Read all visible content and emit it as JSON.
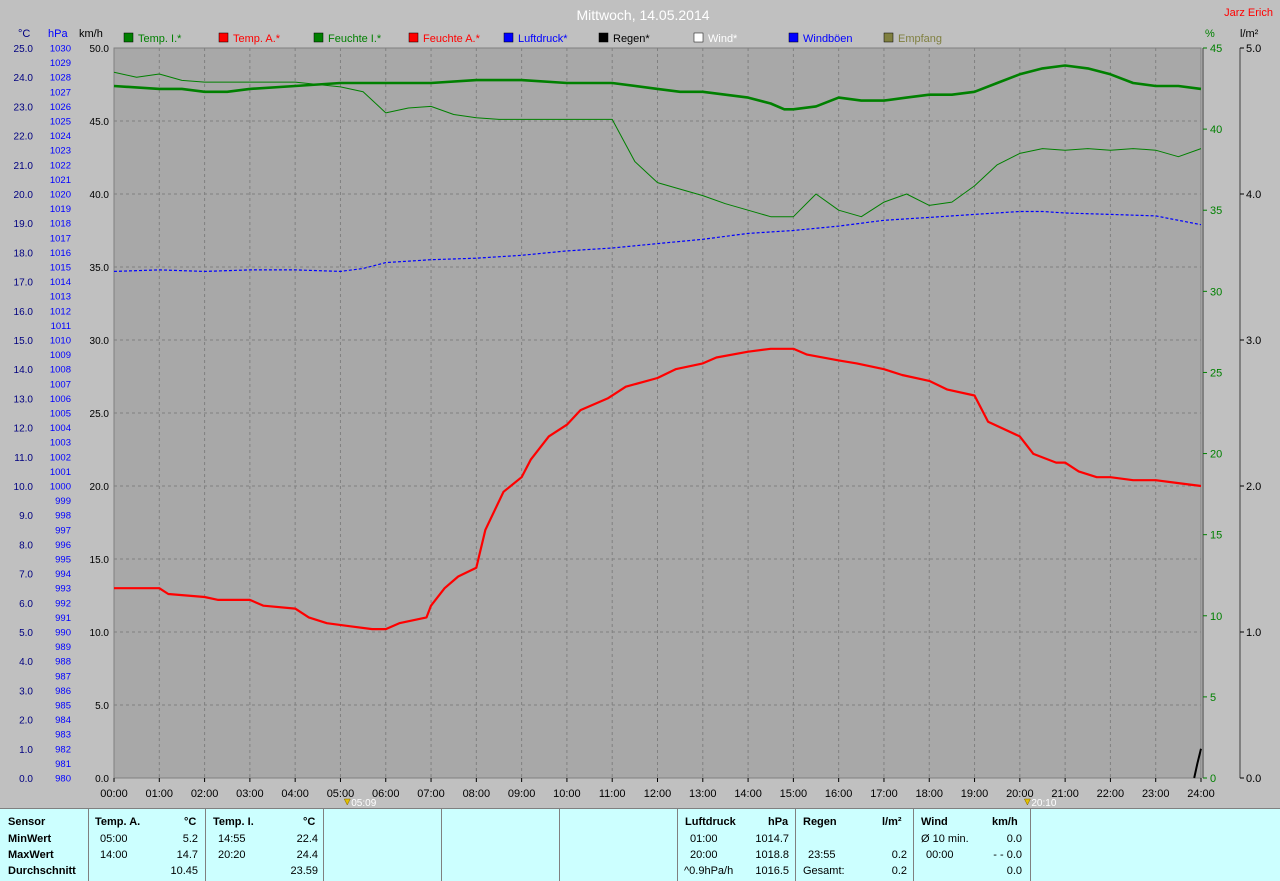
{
  "title": "Mittwoch, 14.05.2014",
  "user": "Jarz Erich",
  "colors": {
    "background": "#c0c0c0",
    "plot_bg": "#a8a8a8",
    "temp_in": "#008000",
    "temp_out": "#ff0000",
    "hum_in": "#008000",
    "pressure": "#0000ff",
    "table_bg": "#ccffff"
  },
  "units": {
    "temp": "°C",
    "pressure": "hPa",
    "speed": "km/h",
    "humidity": "%",
    "rain": "l/m²"
  },
  "legend": [
    {
      "label": "Temp. I.*",
      "color": "#008000"
    },
    {
      "label": "Temp. A.*",
      "color": "#ff0000"
    },
    {
      "label": "Feuchte I.*",
      "color": "#008000"
    },
    {
      "label": "Feuchte A.*",
      "color": "#ff0000"
    },
    {
      "label": "Luftdruck*",
      "color": "#0000ff"
    },
    {
      "label": "Regen*",
      "color": "#000000"
    },
    {
      "label": "Wind*",
      "color": "#ffffff"
    },
    {
      "label": "Windböen",
      "color": "#0000ff"
    },
    {
      "label": "Empfang",
      "color": "#808040"
    }
  ],
  "markers": [
    {
      "time": "05:09",
      "label": "05:09"
    },
    {
      "time": "20:10",
      "label": "20:10"
    }
  ],
  "chart_data": {
    "type": "line",
    "x_ticks": [
      "00:00",
      "01:00",
      "02:00",
      "03:00",
      "04:00",
      "05:00",
      "06:00",
      "07:00",
      "08:00",
      "09:00",
      "10:00",
      "11:00",
      "12:00",
      "13:00",
      "14:00",
      "15:00",
      "16:00",
      "17:00",
      "18:00",
      "19:00",
      "20:00",
      "21:00",
      "22:00",
      "23:00",
      "24:00"
    ],
    "axes": {
      "temp": {
        "ylim": [
          0,
          25
        ],
        "step": 1
      },
      "pressure": {
        "ylim": [
          980,
          1030
        ],
        "step": 1
      },
      "speed": {
        "ylim": [
          0,
          50
        ],
        "step": 5
      },
      "humidity": {
        "ylim": [
          0,
          45
        ],
        "step": 5
      },
      "rain": {
        "ylim": [
          0,
          5
        ],
        "step": 1
      }
    },
    "series": [
      {
        "name": "Temp. A.*",
        "axis": "temp",
        "x": [
          0,
          1,
          1.2,
          2,
          2.3,
          3,
          3.3,
          4,
          4.3,
          4.7,
          5.2,
          5.7,
          6.0,
          6.3,
          6.9,
          7.0,
          7.3,
          7.6,
          8.0,
          8.2,
          8.6,
          9.0,
          9.2,
          9.6,
          10.0,
          10.3,
          10.9,
          11.3,
          12.0,
          12.4,
          13.0,
          13.3,
          14.0,
          14.5,
          15.0,
          15.3,
          16.0,
          16.4,
          17.0,
          17.4,
          18.0,
          18.4,
          19.0,
          19.3,
          20.0,
          20.3,
          20.8,
          21.0,
          21.3,
          21.7,
          22.0,
          22.5,
          23.0,
          23.5,
          24.0
        ],
        "y": [
          6.5,
          6.5,
          6.3,
          6.2,
          6.1,
          6.1,
          5.9,
          5.8,
          5.5,
          5.3,
          5.2,
          5.1,
          5.1,
          5.3,
          5.5,
          5.9,
          6.5,
          6.9,
          7.2,
          8.5,
          9.8,
          10.3,
          10.9,
          11.7,
          12.1,
          12.6,
          13.0,
          13.4,
          13.7,
          14.0,
          14.2,
          14.4,
          14.6,
          14.7,
          14.7,
          14.5,
          14.3,
          14.2,
          14.0,
          13.8,
          13.6,
          13.3,
          13.1,
          12.2,
          11.7,
          11.1,
          10.8,
          10.8,
          10.5,
          10.3,
          10.3,
          10.2,
          10.2,
          10.1,
          10.0
        ]
      },
      {
        "name": "Temp. I.*",
        "axis": "temp",
        "x": [
          0,
          1,
          1.5,
          2,
          2.5,
          3,
          4,
          5,
          5.5,
          6,
          7,
          8,
          9,
          10,
          11,
          12,
          12.5,
          13,
          14,
          14.5,
          14.8,
          15,
          15.5,
          16,
          16.5,
          17,
          17.5,
          18,
          18.5,
          19,
          19.5,
          20,
          20.5,
          21,
          21.5,
          22,
          22.5,
          23,
          23.5,
          24
        ],
        "y": [
          23.7,
          23.6,
          23.6,
          23.5,
          23.5,
          23.6,
          23.7,
          23.8,
          23.8,
          23.8,
          23.8,
          23.9,
          23.9,
          23.8,
          23.8,
          23.6,
          23.5,
          23.5,
          23.3,
          23.1,
          22.9,
          22.9,
          23.0,
          23.3,
          23.2,
          23.2,
          23.3,
          23.4,
          23.4,
          23.5,
          23.8,
          24.1,
          24.3,
          24.4,
          24.3,
          24.1,
          23.8,
          23.7,
          23.7,
          23.6
        ]
      },
      {
        "name": "Feuchte I.*",
        "axis": "humidity",
        "x": [
          0,
          0.5,
          1,
          1.5,
          2,
          3,
          4,
          5,
          5.5,
          6,
          6.5,
          7,
          7.5,
          8,
          8.5,
          9,
          10,
          11,
          11.5,
          12,
          12.5,
          13,
          13.5,
          14,
          14.5,
          15,
          15.5,
          16,
          16.5,
          17,
          17.5,
          18,
          18.5,
          19,
          19.5,
          20,
          20.5,
          21,
          21.5,
          22,
          22.5,
          23,
          23.5,
          24
        ],
        "y": [
          43.5,
          43.2,
          43.4,
          43.0,
          42.9,
          42.9,
          42.9,
          42.6,
          42.3,
          41.0,
          41.3,
          41.4,
          40.9,
          40.7,
          40.6,
          40.6,
          40.6,
          40.6,
          38.0,
          36.7,
          36.3,
          35.9,
          35.4,
          35.0,
          34.6,
          34.6,
          36.0,
          35.0,
          34.6,
          35.5,
          36.0,
          35.3,
          35.5,
          36.5,
          37.8,
          38.5,
          38.8,
          38.7,
          38.8,
          38.7,
          38.8,
          38.7,
          38.3,
          38.8
        ]
      },
      {
        "name": "Luftdruck*",
        "axis": "pressure",
        "x": [
          0,
          1,
          2,
          3,
          4,
          5,
          5.5,
          6,
          7,
          8,
          9,
          10,
          11,
          12,
          13,
          14,
          15,
          16,
          17,
          18,
          19,
          20,
          20.5,
          21,
          22,
          23,
          23.5,
          24
        ],
        "y": [
          1014.7,
          1014.8,
          1014.7,
          1014.8,
          1014.8,
          1014.7,
          1014.9,
          1015.3,
          1015.5,
          1015.6,
          1015.8,
          1016.1,
          1016.3,
          1016.6,
          1016.9,
          1017.3,
          1017.5,
          1017.8,
          1018.2,
          1018.4,
          1018.6,
          1018.8,
          1018.8,
          1018.7,
          1018.6,
          1018.5,
          1018.2,
          1017.9
        ]
      },
      {
        "name": "Regen*",
        "axis": "rain",
        "x": [
          23.85,
          23.92,
          24.0
        ],
        "y": [
          0.0,
          0.1,
          0.2
        ]
      }
    ]
  },
  "table": {
    "sensor": {
      "header": "Sensor",
      "rows": [
        "MinWert",
        "MaxWert",
        "Durchschnitt"
      ]
    },
    "temp_out": {
      "header": "Temp. A.",
      "unit": "°C",
      "min_time": "05:00",
      "min": "5.2",
      "max_time": "14:00",
      "max": "14.7",
      "avg": "10.45"
    },
    "temp_in": {
      "header": "Temp. I.",
      "unit": "°C",
      "min_time": "14:55",
      "min": "22.4",
      "max_time": "20:20",
      "max": "24.4",
      "avg": "23.59"
    },
    "pressure": {
      "header": "Luftdruck",
      "unit": "hPa",
      "min_time": "01:00",
      "min": "1014.7",
      "max_time": "20:00",
      "max": "1018.8",
      "trend": "^0.9hPa/h",
      "avg": "1016.5"
    },
    "rain": {
      "header": "Regen",
      "unit": "l/m²",
      "time": "23:55",
      "value": "0.2",
      "total_label": "Gesamt:",
      "total": "0.2"
    },
    "wind": {
      "header": "Wind",
      "unit": "km/h",
      "avg_label": "Ø 10 min.",
      "avg": "0.0",
      "time": "00:00",
      "max": "- - 0.0",
      "last": "0.0"
    }
  }
}
